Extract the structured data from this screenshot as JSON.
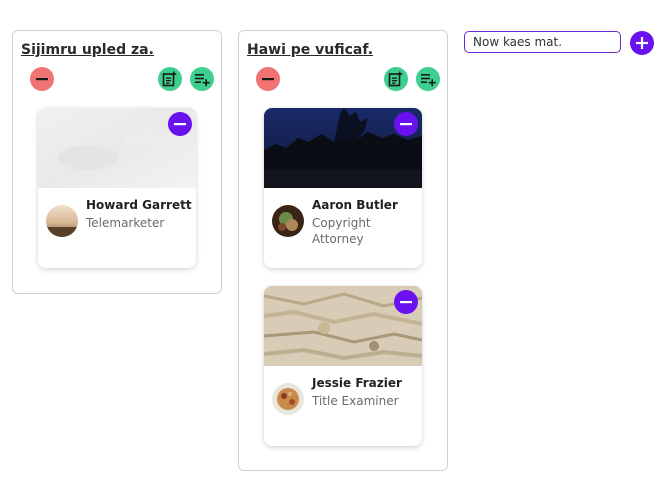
{
  "columns": [
    {
      "title": "Sijimru upled za.",
      "cards": [
        {
          "name": "Howard Garrett",
          "role": "Telemarketer"
        }
      ]
    },
    {
      "title": "Hawi pe vuficaf.",
      "cards": [
        {
          "name": "Aaron Butler",
          "role": "Copyright Attorney"
        },
        {
          "name": "Jessie Frazier",
          "role": "Title Examiner"
        }
      ]
    }
  ],
  "new_column": {
    "value": "Now kaes mat."
  },
  "colors": {
    "remove_column": "#f07272",
    "action_green": "#3ecf8e",
    "accent_purple": "#6a11f0"
  },
  "icons": {
    "remove_column": "minus-circle-icon",
    "add_card": "note-add-icon",
    "add_list": "playlist-add-icon",
    "remove_card": "minus-circle-icon",
    "add_column": "plus-circle-icon"
  }
}
